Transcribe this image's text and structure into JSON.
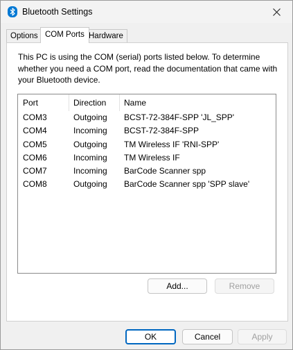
{
  "window": {
    "title": "Bluetooth Settings"
  },
  "tabs": [
    {
      "label": "Options"
    },
    {
      "label": "COM Ports"
    },
    {
      "label": "Hardware"
    }
  ],
  "description": "This PC is using the COM (serial) ports listed below. To determine whether you need a COM port, read the documentation that came with your Bluetooth device.",
  "ports_list": {
    "columns": [
      "Port",
      "Direction",
      "Name"
    ],
    "rows": [
      {
        "port": "COM3",
        "direction": "Outgoing",
        "name": "BCST-72-384F-SPP 'JL_SPP'"
      },
      {
        "port": "COM4",
        "direction": "Incoming",
        "name": "BCST-72-384F-SPP"
      },
      {
        "port": "COM5",
        "direction": "Outgoing",
        "name": "TM Wireless IF 'RNI-SPP'"
      },
      {
        "port": "COM6",
        "direction": "Incoming",
        "name": "TM Wireless IF"
      },
      {
        "port": "COM7",
        "direction": "Incoming",
        "name": "BarCode Scanner spp"
      },
      {
        "port": "COM8",
        "direction": "Outgoing",
        "name": "BarCode Scanner spp 'SPP slave'"
      }
    ]
  },
  "list_buttons": {
    "add": "Add...",
    "remove": "Remove"
  },
  "dialog_buttons": {
    "ok": "OK",
    "cancel": "Cancel",
    "apply": "Apply"
  },
  "icons": {
    "title": "bluetooth-icon",
    "close": "close-icon"
  },
  "colors": {
    "accent": "#0067c0",
    "bluetooth": "#0078d4"
  }
}
